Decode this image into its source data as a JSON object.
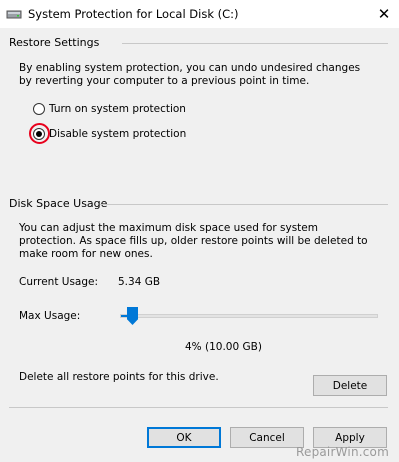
{
  "window": {
    "title": "System Protection for Local Disk (C:)",
    "close_glyph": "✕"
  },
  "restore_settings": {
    "group_title": "Restore Settings",
    "description": "By enabling system protection, you can undo undesired changes by reverting your computer to a previous point in time.",
    "options": [
      {
        "label": "Turn on system protection",
        "checked": false
      },
      {
        "label": "Disable system protection",
        "checked": true
      }
    ],
    "highlight_color": "#e8001c"
  },
  "disk_space": {
    "group_title": "Disk Space Usage",
    "description": "You can adjust the maximum disk space used for system protection. As space fills up, older restore points will be deleted to make room for new ones.",
    "current_usage_label": "Current Usage:",
    "current_usage_value": "5.34 GB",
    "max_usage_label": "Max Usage:",
    "max_usage_fraction": 0.04,
    "max_usage_value": "4% (10.00 GB)",
    "delete_description": "Delete all restore points for this drive.",
    "delete_button": "Delete",
    "accent_color": "#0078d7"
  },
  "footer": {
    "ok_button": "OK",
    "cancel_button": "Cancel",
    "apply_button": "Apply"
  },
  "watermark": "RepairWin.com"
}
